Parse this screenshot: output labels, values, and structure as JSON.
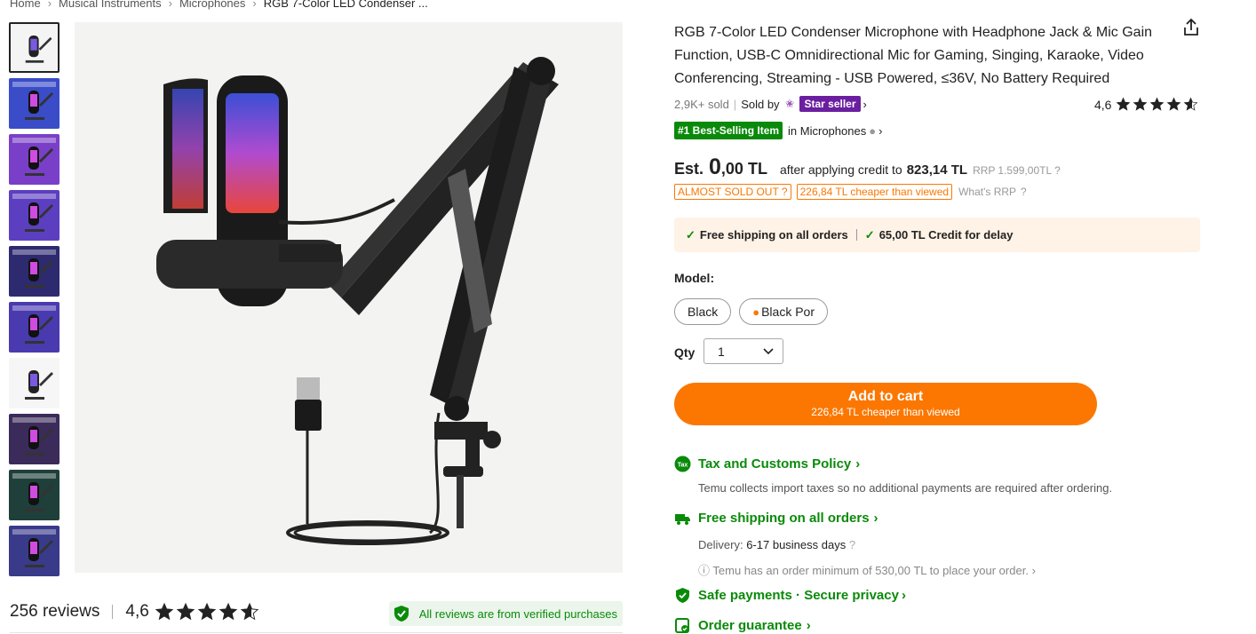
{
  "breadcrumb": [
    "Home",
    "Musical Instruments",
    "Microphones",
    "RGB 7-Color LED Condenser ..."
  ],
  "breadcrumb_sep": "›",
  "thumbnails": [
    {
      "name": "mic-product-thumb",
      "color": "#f4f4f4"
    },
    {
      "name": "mic-feature-thumb",
      "color": "#3a4cc8"
    },
    {
      "name": "mic-pickup-thumb",
      "color": "#7a3fc8"
    },
    {
      "name": "in-the-box-thumb",
      "color": "#5c3fc0"
    },
    {
      "name": "mic-rgb-thumb",
      "color": "#2e2a70"
    },
    {
      "name": "mic-streaming-thumb",
      "color": "#4a3ab0"
    },
    {
      "name": "mic-diagram-thumb",
      "color": "#f6f6f6"
    },
    {
      "name": "cardioid-pickup-thumb",
      "color": "#3b2b5a"
    },
    {
      "name": "gaming-setup-thumb",
      "color": "#1f3f3a"
    },
    {
      "name": "streaming-room-thumb",
      "color": "#3a3a8a"
    }
  ],
  "title": "RGB 7-Color LED Condenser Microphone with Headphone Jack & Mic Gain Function, USB-C Omnidirectional Mic for Gaming, Singing, Karaoke, Video Conferencing, Streaming - USB Powered, ≤36V, No Battery Required",
  "meta": {
    "sold": "2,9K+ sold",
    "sold_by": "Sold by",
    "star_seller": "Star seller",
    "chevron": "›"
  },
  "rating": {
    "value": "4,6",
    "stars": 4.6
  },
  "bestseller": {
    "badge": "#1 Best-Selling Item",
    "category": "in Microphones",
    "chevron": "›"
  },
  "price": {
    "est": "Est.",
    "whole": "0",
    "decimal": ",00 TL",
    "after": "after applying credit to",
    "credit": "823,14 TL",
    "rrp_label": "RRP",
    "rrp_value": "1.599,00TL"
  },
  "tags": {
    "almost_sold_out": "ALMOST SOLD OUT",
    "cheaper": "226,84 TL cheaper than viewed",
    "what_rrp": "What's RRP"
  },
  "shipbar": {
    "free_shipping": "Free shipping on all orders",
    "credit_delay": "65,00 TL Credit for delay"
  },
  "model": {
    "label": "Model:",
    "options": [
      "Black",
      "Black Por"
    ]
  },
  "qty": {
    "label": "Qty",
    "value": "1"
  },
  "cart": {
    "label": "Add to cart",
    "sub": "226,84 TL cheaper than viewed"
  },
  "features": {
    "tax_icon_text": "Tax",
    "tax_title": "Tax and Customs Policy",
    "tax_desc": "Temu collects import taxes so no additional payments are required after ordering.",
    "ship_title": "Free shipping on all orders",
    "delivery_label": "Delivery:",
    "delivery_value": "6-17 business days",
    "order_min": "Temu has an order minimum of 530,00 TL to place your order.",
    "safe_title": "Safe payments · Secure privacy",
    "guarantee_title": "Order guarantee",
    "chevron": "›"
  },
  "reviews": {
    "count": "256 reviews",
    "rating": "4,6",
    "verified": "All reviews are from verified purchases"
  },
  "colors": {
    "accent": "#fb7701",
    "green": "#0a8a0a",
    "star_seller": "#6b1fa0"
  }
}
